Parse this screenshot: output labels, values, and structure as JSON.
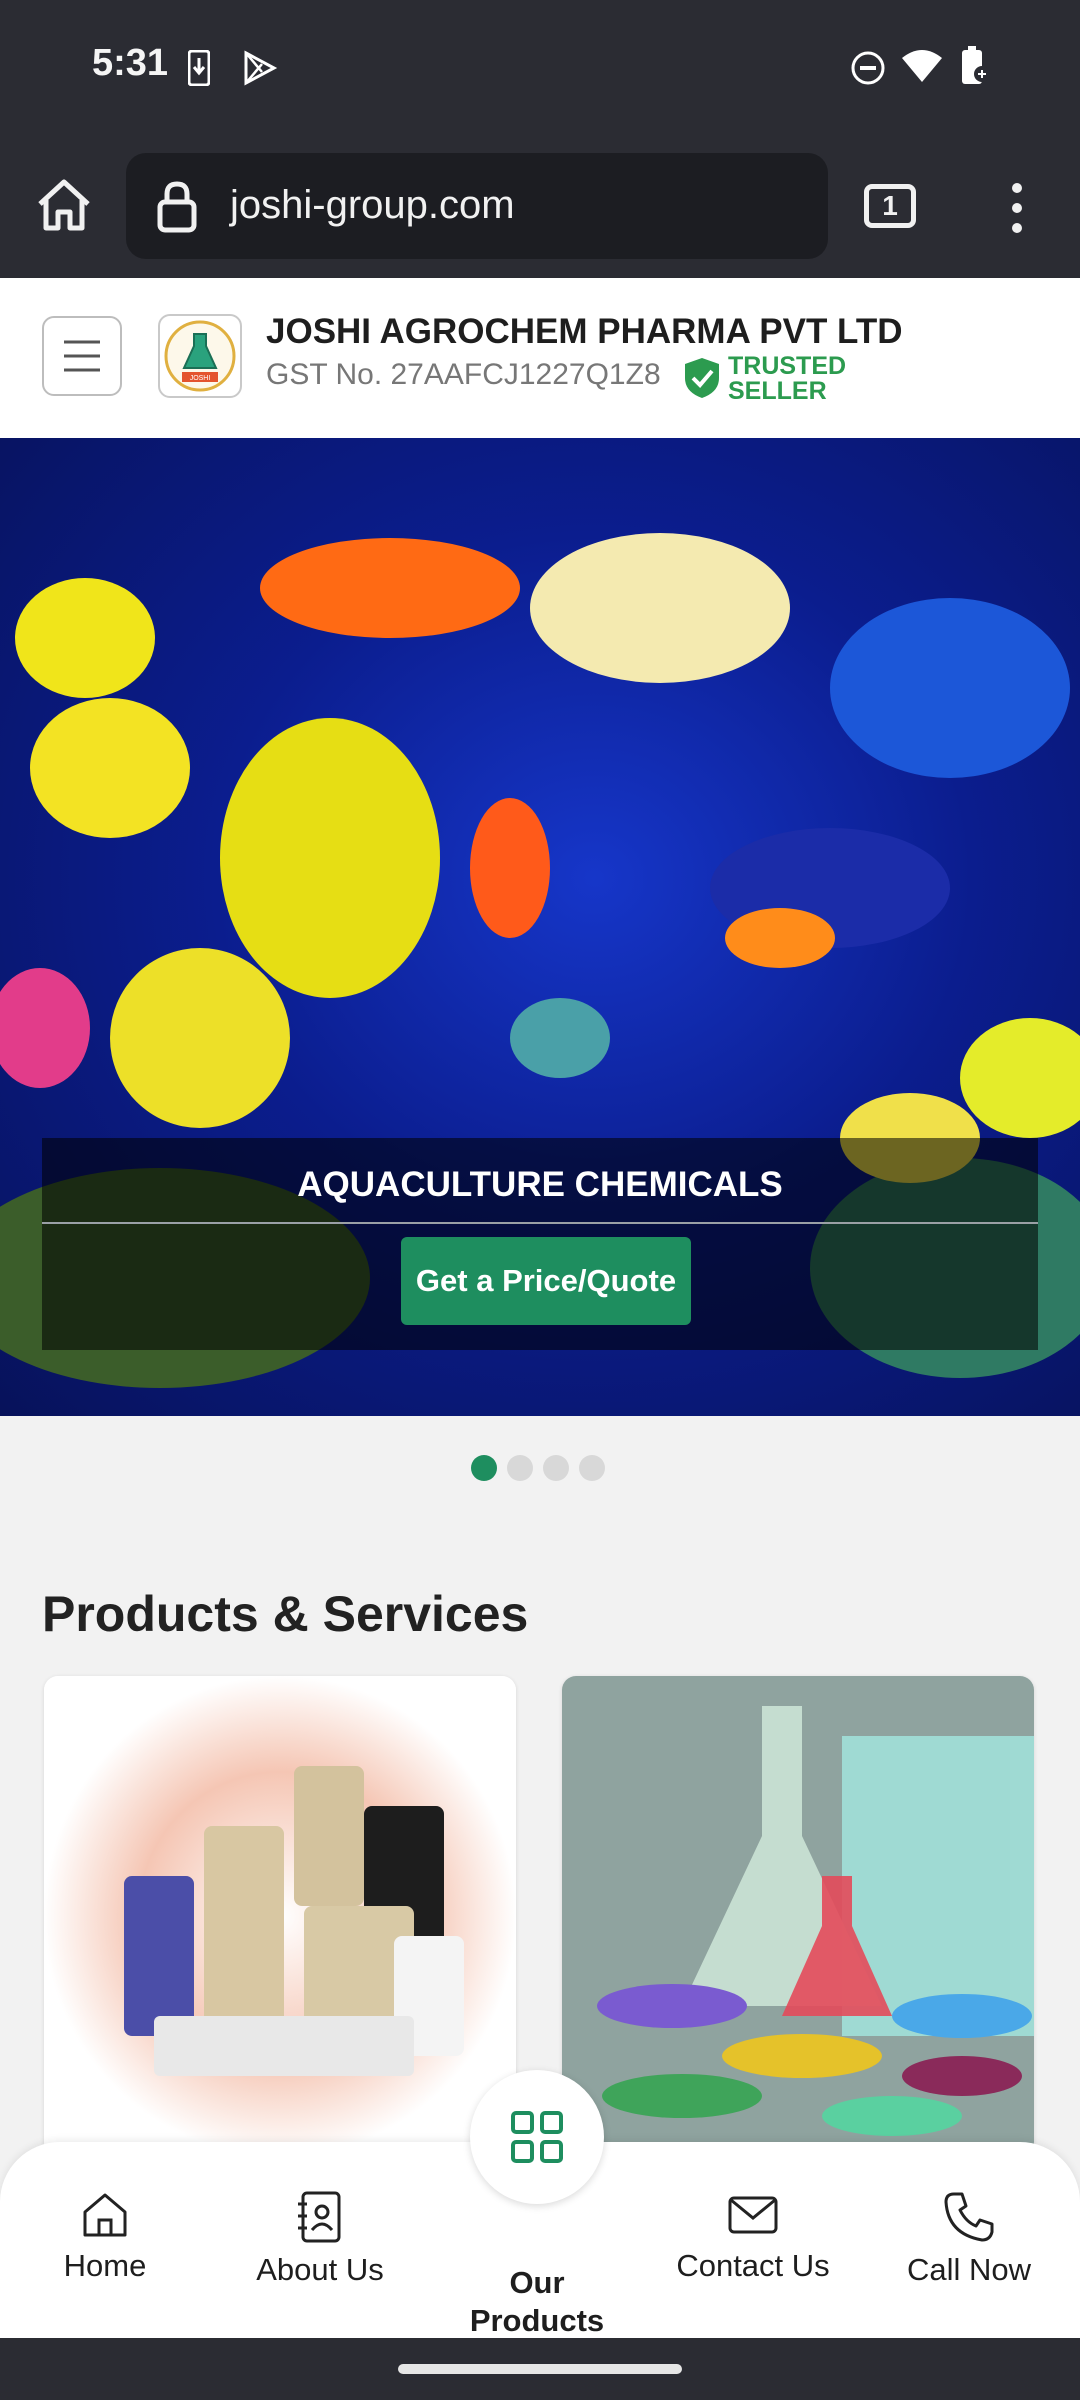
{
  "status_bar": {
    "time": "5:31"
  },
  "browser": {
    "url": "joshi-group.com",
    "tab_count": "1"
  },
  "header": {
    "company_name": "JOSHI AGROCHEM PHARMA PVT LTD",
    "gst": "GST No. 27AAFCJ1227Q1Z8",
    "trusted_line1": "TRUSTED",
    "trusted_line2": "SELLER",
    "logo_text": "JOSHI"
  },
  "hero": {
    "caption": "AQUACULTURE CHEMICALS",
    "button_label": "Get a Price/Quote",
    "slides_total": 4,
    "active_slide": 1
  },
  "products": {
    "title": "Products & Services"
  },
  "bottom_nav": {
    "items": [
      {
        "label": "Home",
        "icon": "home-icon"
      },
      {
        "label": "About Us",
        "icon": "contacts-book-icon"
      },
      {
        "label": "Our\nProducts",
        "icon": "grid-icon"
      },
      {
        "label": "Contact Us",
        "icon": "mail-icon"
      },
      {
        "label": "Call Now",
        "icon": "phone-icon"
      }
    ]
  },
  "colors": {
    "accent": "#1e8e5f",
    "trusted": "#2c9b4f",
    "chrome": "#2b2c33"
  }
}
